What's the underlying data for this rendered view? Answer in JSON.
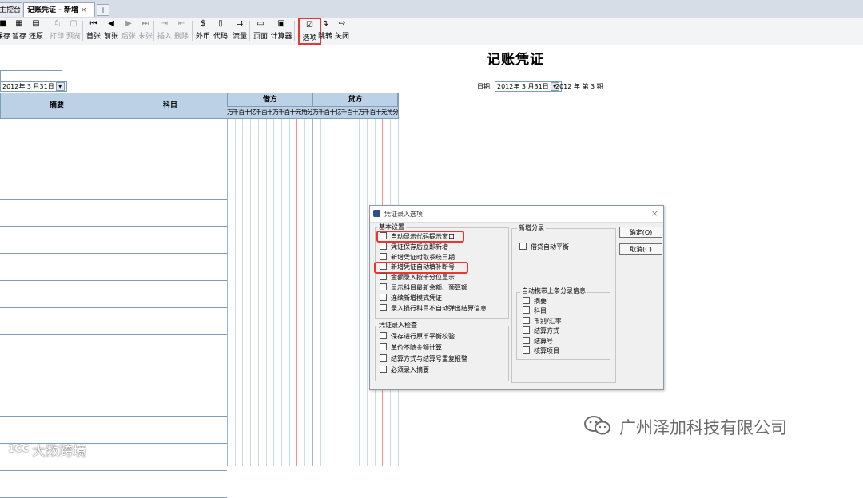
{
  "tabs": [
    {
      "label": "主控台",
      "active": false
    },
    {
      "label": "记账凭证 - 新增",
      "active": true,
      "close": "×"
    }
  ],
  "toolbar": {
    "buttons": [
      {
        "label": "保存",
        "icon": "save-icon",
        "glyph": "■",
        "disabled": false
      },
      {
        "label": "暂存",
        "icon": "temp-save-icon",
        "glyph": "▦",
        "disabled": false
      },
      {
        "label": "还原",
        "icon": "restore-icon",
        "glyph": "▤",
        "disabled": false
      },
      {
        "label": "打印",
        "icon": "print-icon",
        "glyph": "⎙",
        "disabled": true
      },
      {
        "label": "预览",
        "icon": "preview-icon",
        "glyph": "▢",
        "disabled": true
      },
      {
        "label": "首张",
        "icon": "first-icon",
        "glyph": "⏮",
        "disabled": false
      },
      {
        "label": "前张",
        "icon": "prev-icon",
        "glyph": "◀",
        "disabled": false
      },
      {
        "label": "后张",
        "icon": "next-icon",
        "glyph": "▶",
        "disabled": true
      },
      {
        "label": "末张",
        "icon": "last-icon",
        "glyph": "⏭",
        "disabled": true
      },
      {
        "label": "插入",
        "icon": "insert-icon",
        "glyph": "⇥",
        "disabled": true
      },
      {
        "label": "删除",
        "icon": "delete-icon",
        "glyph": "⇤",
        "disabled": true
      },
      {
        "label": "外币",
        "icon": "currency-icon",
        "glyph": "$",
        "disabled": false
      },
      {
        "label": "代码",
        "icon": "code-icon",
        "glyph": "▯",
        "disabled": false
      },
      {
        "label": "流量",
        "icon": "flow-icon",
        "glyph": "⇉",
        "disabled": false
      },
      {
        "label": "页面",
        "icon": "page-icon",
        "glyph": "▭",
        "disabled": false
      },
      {
        "label": "计算器",
        "icon": "calculator-icon",
        "glyph": "▣",
        "disabled": false
      },
      {
        "label": "选项",
        "icon": "options-icon",
        "glyph": "☑",
        "disabled": false,
        "highlighted": true
      },
      {
        "label": "跳转",
        "icon": "jump-icon",
        "glyph": "↴",
        "disabled": false
      },
      {
        "label": "关闭",
        "icon": "close-doc-icon",
        "glyph": "⇨",
        "disabled": false
      }
    ]
  },
  "voucher": {
    "title": "记账凭证",
    "top_date": "2012年 3 月31日",
    "date_label": "日期:",
    "date_value": "2012年 3 月31日",
    "period_text": "2012 年 第 3 期"
  },
  "grid": {
    "col_summary": "摘要",
    "col_account": "科目",
    "col_debit": "借方",
    "col_credit": "贷方",
    "digits": [
      "万",
      "千",
      "百",
      "十",
      "亿",
      "千",
      "百",
      "十",
      "万",
      "千",
      "百",
      "十",
      "元",
      "角",
      "分"
    ]
  },
  "dialog": {
    "title": "凭证录入选项",
    "close": "×",
    "basic_group": "基本设置",
    "basic_options": [
      "自动显示代码提示窗口",
      "凭证保存后立即新增",
      "新增凭证时取系统日期",
      "新增凭证自动填补断号",
      "金额录入按千分位显示",
      "显示科目最新余额、预算额",
      "连续新增模式凭证",
      "录入损行科目不自动弹出结算信息"
    ],
    "check_group": "凭证录入检查",
    "check_options": [
      "保存进行原币平衡校验",
      "单价不随金额计算",
      "结算方式与结算号重复报警",
      "必须录入摘要"
    ],
    "new_entry_group": "新增分录",
    "new_entry_options": [
      "借贷自动平衡"
    ],
    "auto_carry_group": "自动携带上条分录信息",
    "auto_carry_options": [
      "摘要",
      "科目",
      "币别/汇率",
      "结算方式",
      "结算号",
      "核算项目"
    ],
    "ok_button": "确定(O)",
    "cancel_button": "取消(C)"
  },
  "watermark": {
    "company": "广州泽加科技有限公司",
    "brand": "大数跨境",
    "brand_logo": "1CC"
  }
}
